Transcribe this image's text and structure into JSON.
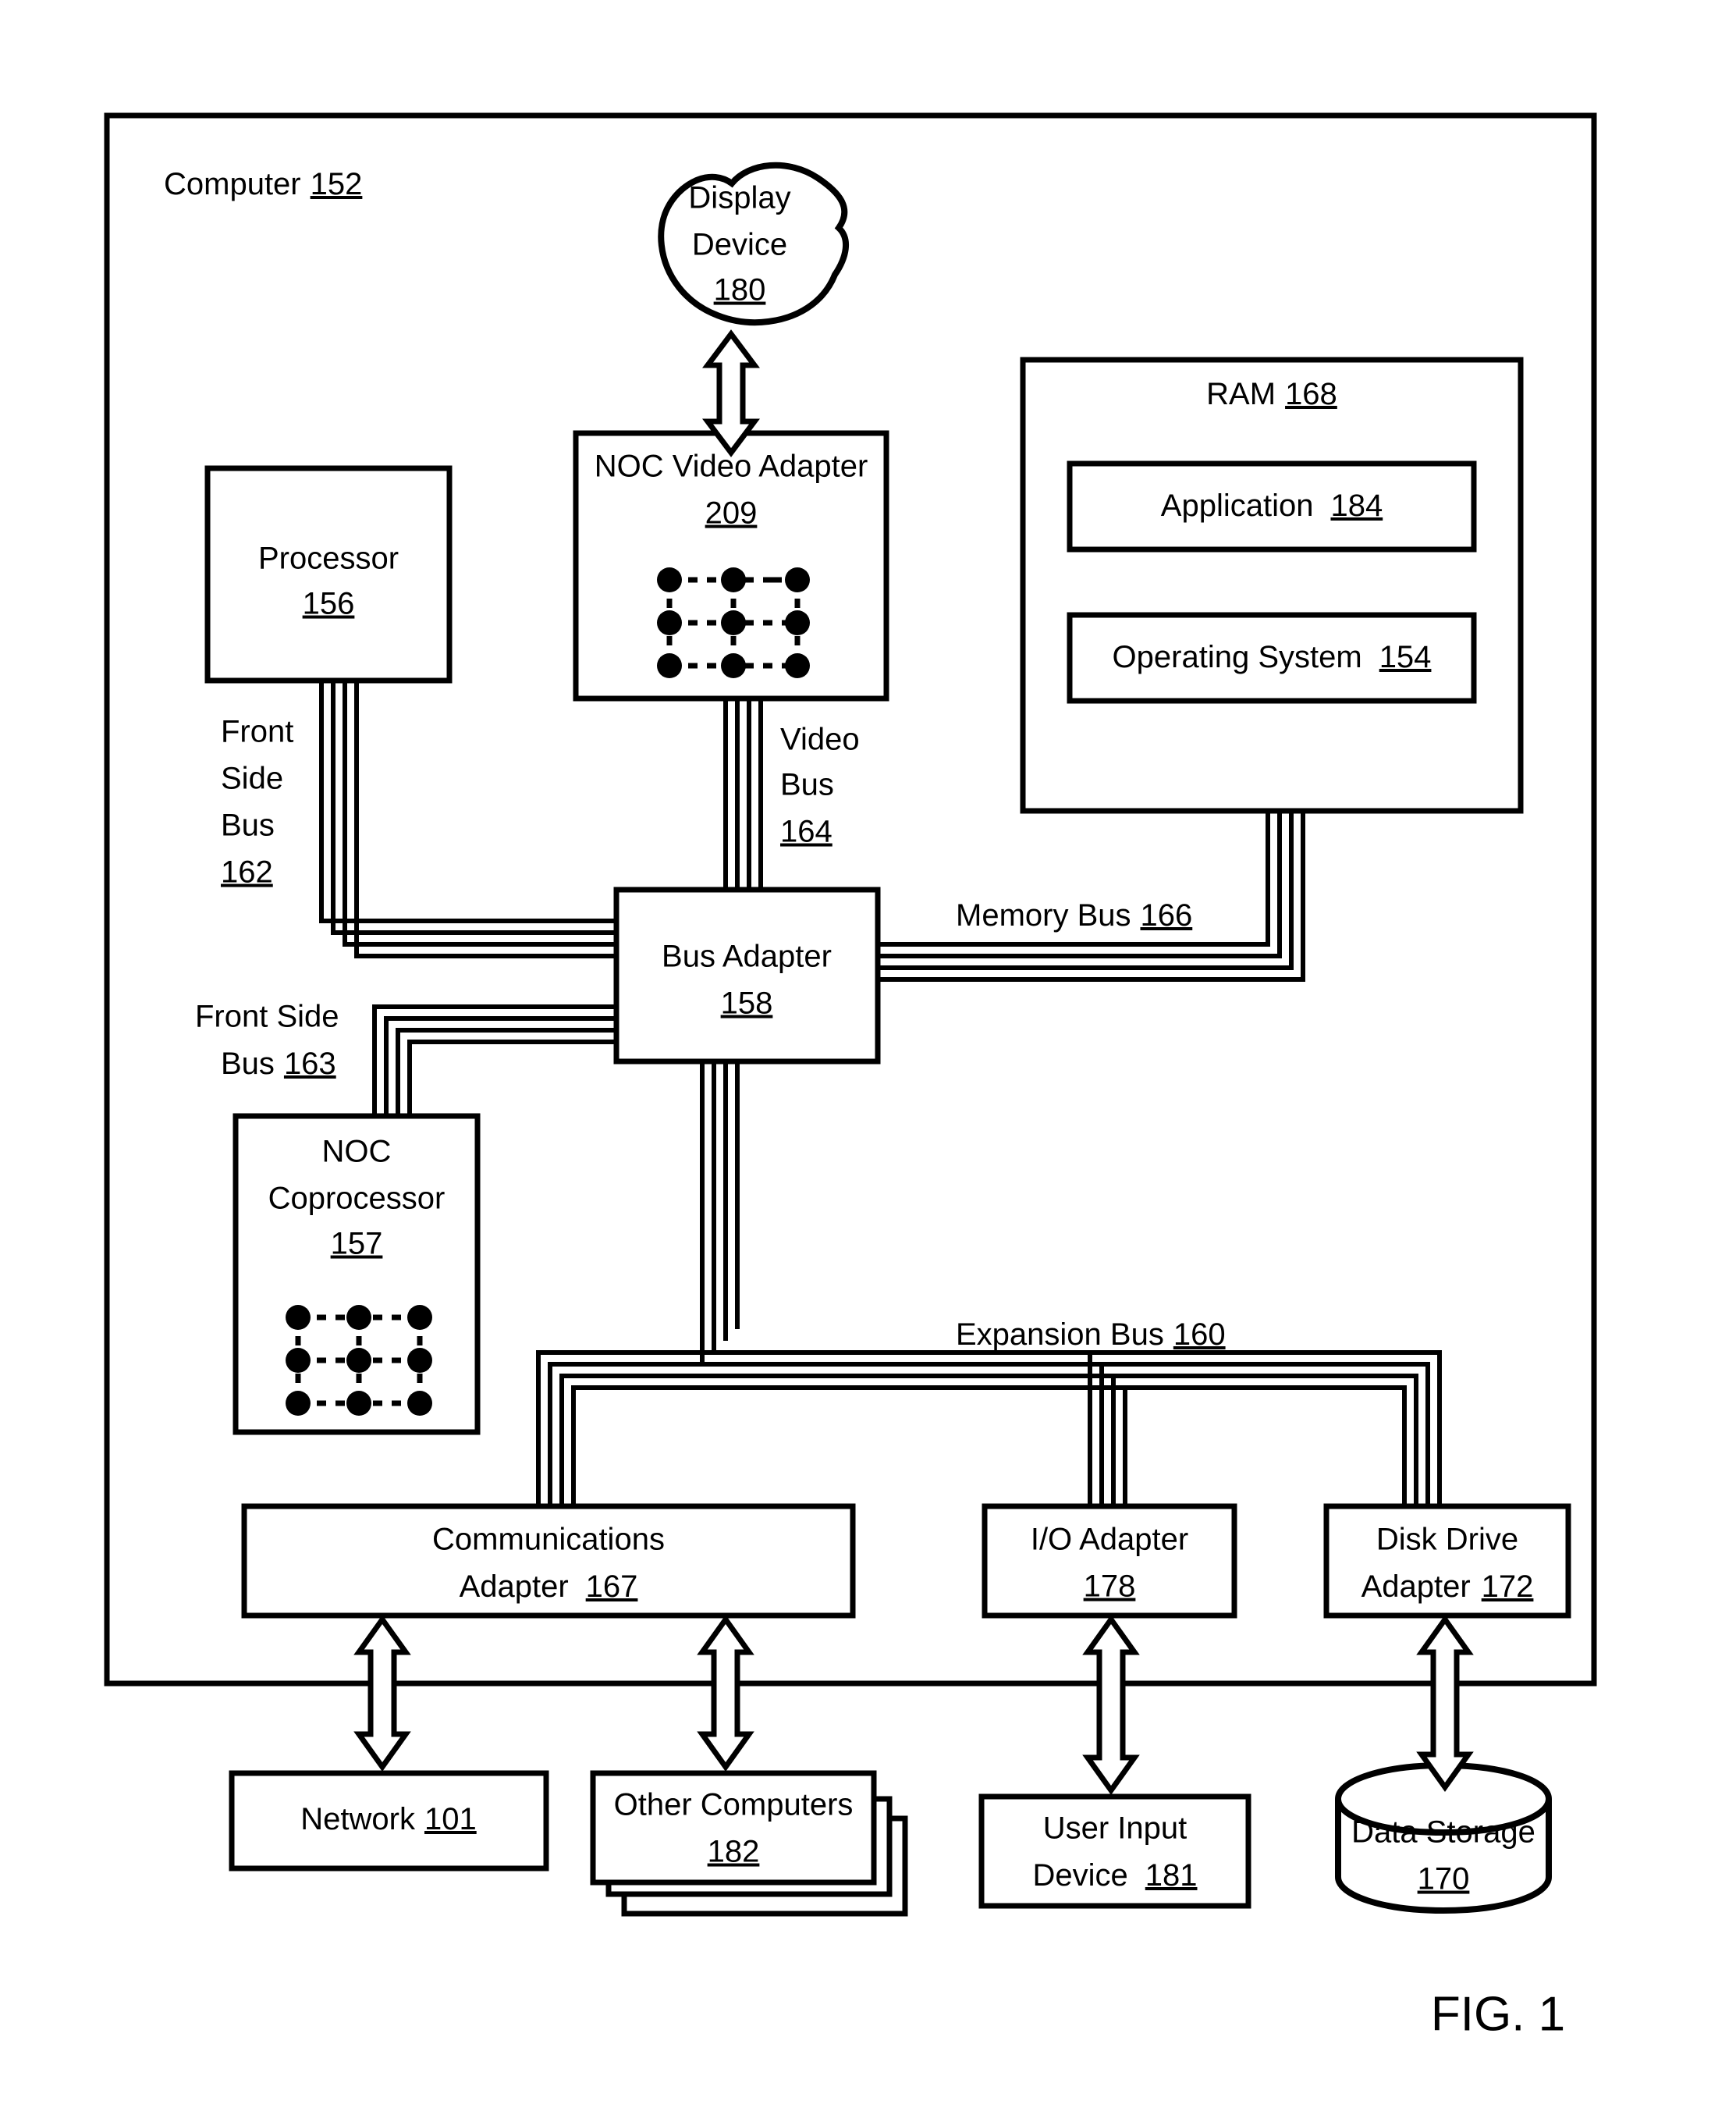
{
  "figure": {
    "caption": "FIG. 1",
    "enclosure_label": "Computer",
    "enclosure_ref": "152"
  },
  "nodes": {
    "display_device": {
      "line1": "Display",
      "line2": "Device",
      "ref": "180",
      "shape": "blob"
    },
    "noc_video_adapter": {
      "line1": "NOC Video Adapter",
      "ref": "209",
      "shape": "rect",
      "mesh": "3x3"
    },
    "processor": {
      "line1": "Processor",
      "ref": "156",
      "shape": "rect"
    },
    "ram": {
      "line1": "RAM",
      "ref": "168",
      "shape": "rect"
    },
    "application": {
      "line1": "Application",
      "ref": "184",
      "shape": "rect"
    },
    "operating_system": {
      "line1": "Operating System",
      "ref": "154",
      "shape": "rect"
    },
    "bus_adapter": {
      "line1": "Bus Adapter",
      "ref": "158",
      "shape": "rect"
    },
    "noc_coprocessor": {
      "line1": "NOC",
      "line2": "Coprocessor",
      "ref": "157",
      "shape": "rect",
      "mesh": "3x3"
    },
    "communications_adapter": {
      "line1": "Communications",
      "line2": "Adapter",
      "ref": "167",
      "shape": "rect"
    },
    "io_adapter": {
      "line1": "I/O Adapter",
      "ref": "178",
      "shape": "rect"
    },
    "disk_drive_adapter": {
      "line1": "Disk Drive",
      "line2": "Adapter",
      "ref": "172",
      "shape": "rect"
    },
    "network": {
      "line1": "Network",
      "ref": "101",
      "shape": "rect"
    },
    "other_computers": {
      "line1": "Other Computers",
      "ref": "182",
      "shape": "stacked-rect"
    },
    "user_input_device": {
      "line1": "User Input",
      "line2": "Device",
      "ref": "181",
      "shape": "rect"
    },
    "data_storage": {
      "line1": "Data Storage",
      "ref": "170",
      "shape": "cylinder"
    }
  },
  "buses": {
    "front_side_bus_162": {
      "l1": "Front",
      "l2": "Side",
      "l3": "Bus",
      "ref": "162"
    },
    "video_bus_164": {
      "l1": "Video",
      "l2": "Bus",
      "ref": "164"
    },
    "memory_bus_166": {
      "l1": "Memory Bus",
      "ref": "166"
    },
    "front_side_bus_163": {
      "l1": "Front Side",
      "l2": "Bus",
      "ref": "163"
    },
    "expansion_bus_160": {
      "l1": "Expansion Bus",
      "ref": "160"
    }
  },
  "colors": {
    "ink": "#000000",
    "paper": "#ffffff"
  }
}
